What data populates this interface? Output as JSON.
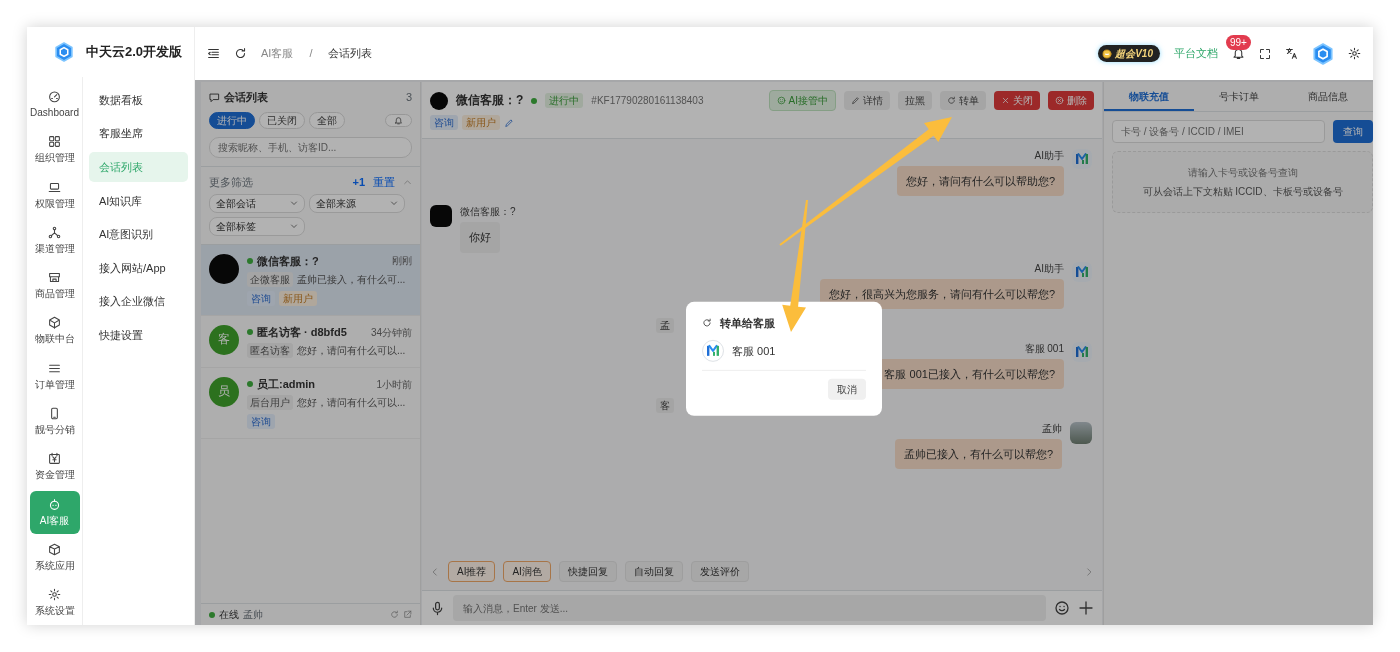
{
  "brand": {
    "title": "中天云2.0开发版"
  },
  "rail": [
    {
      "label": "Dashboard",
      "selected": false
    },
    {
      "label": "组织管理",
      "selected": false
    },
    {
      "label": "权限管理",
      "selected": false
    },
    {
      "label": "渠道管理",
      "selected": false
    },
    {
      "label": "商品管理",
      "selected": false
    },
    {
      "label": "物联中台",
      "selected": false
    },
    {
      "label": "订单管理",
      "selected": false
    },
    {
      "label": "靓号分销",
      "selected": false
    },
    {
      "label": "资金管理",
      "selected": false
    },
    {
      "label": "AI客服",
      "selected": true
    },
    {
      "label": "系统应用",
      "selected": false
    },
    {
      "label": "系统设置",
      "selected": false
    }
  ],
  "submenu": [
    {
      "label": "数据看板",
      "selected": false
    },
    {
      "label": "客服坐席",
      "selected": false
    },
    {
      "label": "会话列表",
      "selected": true
    },
    {
      "label": "AI知识库",
      "selected": false
    },
    {
      "label": "AI意图识别",
      "selected": false
    },
    {
      "label": "接入网站/App",
      "selected": false
    },
    {
      "label": "接入企业微信",
      "selected": false
    },
    {
      "label": "快捷设置",
      "selected": false
    }
  ],
  "topbar": {
    "breadcrumb": [
      "AI客服",
      "会话列表"
    ],
    "separator": "/",
    "vip_badge": "超会V10",
    "docs_link": "平台文档",
    "notification_count": "99+"
  },
  "conversation_list": {
    "title": "会话列表",
    "count": "3",
    "filters": [
      {
        "label": "进行中",
        "selected": true
      },
      {
        "label": "已关闭",
        "selected": false
      },
      {
        "label": "全部",
        "selected": false
      }
    ],
    "search": {
      "placeholder": "搜索昵称、手机、访客ID..."
    },
    "more_filters": {
      "label": "更多筛选",
      "badge": "+1",
      "reset": "重置",
      "expanded": true
    },
    "selects": [
      "全部会话",
      "全部来源",
      "全部标签"
    ],
    "conversations": [
      {
        "name": "微信客服：?",
        "online": true,
        "time": "刚刚",
        "source": "企微客服",
        "preview": "孟帅已接入，有什么可...",
        "avatar": {
          "kind": "image"
        },
        "tags": [
          {
            "label": "咨询",
            "kind": "topic"
          },
          {
            "label": "新用户",
            "kind": "new"
          }
        ],
        "selected": true
      },
      {
        "name": "匿名访客 · d8bfd5",
        "online": true,
        "time": "34分钟前",
        "source": "匿名访客",
        "preview": "您好，请问有什么可以...",
        "avatar": {
          "kind": "letter",
          "text": "客"
        },
        "selected": false
      },
      {
        "name": "员工:admin",
        "online": true,
        "time": "1小时前",
        "source": "后台用户",
        "preview": "您好，请问有什么可以...",
        "avatar": {
          "kind": "letter",
          "text": "员"
        },
        "tags": [
          {
            "label": "咨询",
            "kind": "topic"
          }
        ],
        "selected": false
      }
    ],
    "footer": {
      "status": "在线",
      "online": true,
      "user": "孟帅"
    }
  },
  "chat": {
    "title": "微信客服：?",
    "online": true,
    "status": "进行中",
    "id": "#KF17790280161138403",
    "actions": [
      {
        "label": "AI接管中",
        "kind": "success"
      },
      {
        "label": "详情",
        "kind": "light"
      },
      {
        "label": "拉黑",
        "kind": "light"
      },
      {
        "label": "转单",
        "kind": "light"
      },
      {
        "label": "关闭",
        "kind": "danger"
      },
      {
        "label": "删除",
        "kind": "danger"
      }
    ],
    "tags": [
      {
        "label": "咨询",
        "kind": "topic"
      },
      {
        "label": "新用户",
        "kind": "new"
      }
    ],
    "messages": [
      {
        "kind": "outgoing",
        "sender": "AI助手",
        "avatar": {
          "kind": "logo"
        },
        "text": "您好，请问有什么可以帮助您?"
      },
      {
        "kind": "incoming",
        "sender": "微信客服：?",
        "avatar": {
          "kind": "image"
        },
        "text": "你好"
      },
      {
        "kind": "outgoing",
        "sender": "AI助手",
        "avatar": {
          "kind": "logo"
        },
        "text": "您好，很高兴为您服务，请问有什么可以帮您?"
      },
      {
        "kind": "system",
        "text": "孟"
      },
      {
        "kind": "outgoing",
        "sender": "客服 001",
        "avatar": {
          "kind": "logo"
        },
        "text": "客服 001已接入，有什么可以帮您?"
      },
      {
        "kind": "system",
        "text": "客"
      },
      {
        "kind": "outgoing",
        "sender": "孟帅",
        "avatar": {
          "kind": "photo"
        },
        "text": "孟帅已接入，有什么可以帮您?"
      }
    ],
    "quick_actions": [
      {
        "label": "AI推荐",
        "highlighted": true
      },
      {
        "label": "AI润色",
        "highlighted": true
      },
      {
        "label": "快捷回复",
        "highlighted": false
      },
      {
        "label": "自动回复",
        "highlighted": false
      },
      {
        "label": "发送评价",
        "highlighted": false
      }
    ],
    "composer": {
      "placeholder": "输入消息，Enter 发送..."
    }
  },
  "right_panel": {
    "tabs": [
      {
        "label": "物联充值",
        "selected": true
      },
      {
        "label": "号卡订单",
        "selected": false
      },
      {
        "label": "商品信息",
        "selected": false
      }
    ],
    "search": {
      "placeholder": "卡号 / 设备号 / ICCID / IMEI",
      "button": "查询"
    },
    "empty": {
      "title": "请输入卡号或设备号查询",
      "hint": "可从会话上下文粘贴 ICCID、卡板号或设备号"
    }
  },
  "dialog": {
    "title": "转单给客服",
    "agents": [
      {
        "name": "客服 001"
      }
    ],
    "cancel": "取消"
  }
}
